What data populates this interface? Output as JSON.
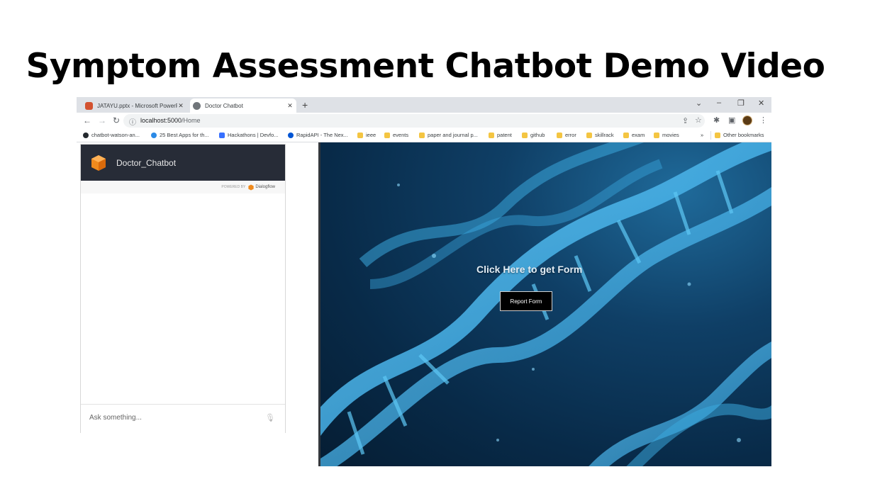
{
  "slide": {
    "title": "Symptom Assessment Chatbot Demo Video"
  },
  "browser": {
    "tabs": [
      {
        "title": "JATAYU.pptx - Microsoft PowerPo",
        "icon": "powerpoint-icon",
        "color": "#d35230"
      },
      {
        "title": "Doctor Chatbot",
        "icon": "globe-icon",
        "color": "#5f6368"
      }
    ],
    "url_host": "localhost:5000",
    "url_path": "/Home",
    "bookmarks": [
      {
        "label": "chatbot-watson-an...",
        "icon": "github-icon"
      },
      {
        "label": "25 Best Apps for th...",
        "icon": "app-icon"
      },
      {
        "label": "Hackathons | Devfo...",
        "icon": "devfolio-icon"
      },
      {
        "label": "RapidAPI - The Nex...",
        "icon": "rapidapi-icon"
      },
      {
        "label": "ieee",
        "icon": "folder-icon"
      },
      {
        "label": "events",
        "icon": "folder-icon"
      },
      {
        "label": "paper and journal p...",
        "icon": "folder-icon"
      },
      {
        "label": "patent",
        "icon": "folder-icon"
      },
      {
        "label": "github",
        "icon": "folder-icon"
      },
      {
        "label": "error",
        "icon": "folder-icon"
      },
      {
        "label": "skillrack",
        "icon": "folder-icon"
      },
      {
        "label": "exam",
        "icon": "folder-icon"
      },
      {
        "label": "movies",
        "icon": "folder-icon"
      }
    ],
    "overflow": "»",
    "other_bookmarks": "Other bookmarks"
  },
  "chatbot": {
    "title": "Doctor_Chatbot",
    "powered_by": "POWERED BY",
    "brand": "Dialogflow",
    "input_placeholder": "Ask something..."
  },
  "hero": {
    "cta_text": "Click Here to get Form",
    "button_label": "Report Form"
  }
}
